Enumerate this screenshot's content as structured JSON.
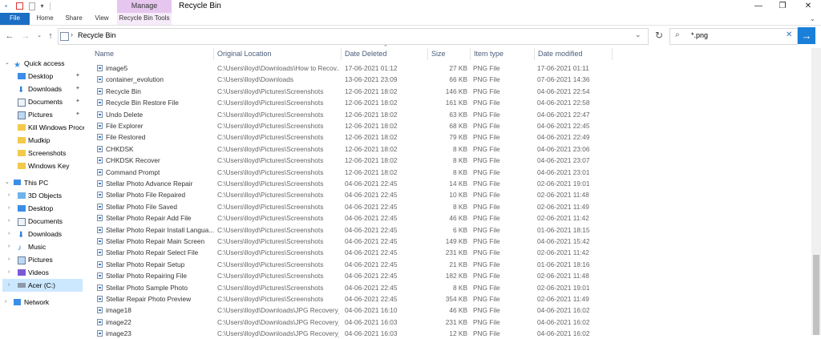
{
  "window": {
    "manage_label": "Manage",
    "title": "Recycle Bin",
    "minimize": "—",
    "restore": "❐",
    "close": "✕"
  },
  "ribbon": {
    "tabs": [
      "File",
      "Home",
      "Share",
      "View",
      "Recycle Bin Tools"
    ]
  },
  "address": {
    "location": "Recycle Bin",
    "search_query": "*.png"
  },
  "nav": {
    "quick_access": "Quick access",
    "quick_items": [
      "Desktop",
      "Downloads",
      "Documents",
      "Pictures",
      "Kill Windows Proces",
      "Mudkip",
      "Screenshots",
      "Windows Key"
    ],
    "this_pc": "This PC",
    "pc_items": [
      "3D Objects",
      "Desktop",
      "Documents",
      "Downloads",
      "Music",
      "Pictures",
      "Videos",
      "Acer (C:)"
    ],
    "network": "Network"
  },
  "columns": {
    "name": "Name",
    "location": "Original Location",
    "date_deleted": "Date Deleted",
    "size": "Size",
    "type": "Item type",
    "modified": "Date modified"
  },
  "files": [
    {
      "name": "image5",
      "loc": "C:\\Users\\lloyd\\Downloads\\How to Recov...",
      "deleted": "17-06-2021 01:12",
      "size": "27 KB",
      "type": "PNG File",
      "modified": "17-06-2021 01:11"
    },
    {
      "name": "container_evolution",
      "loc": "C:\\Users\\lloyd\\Downloads",
      "deleted": "13-06-2021 23:09",
      "size": "66 KB",
      "type": "PNG File",
      "modified": "07-06-2021 14:36"
    },
    {
      "name": "Recycle Bin",
      "loc": "C:\\Users\\lloyd\\Pictures\\Screenshots",
      "deleted": "12-06-2021 18:02",
      "size": "146 KB",
      "type": "PNG File",
      "modified": "04-06-2021 22:54"
    },
    {
      "name": "Recycle Bin Restore File",
      "loc": "C:\\Users\\lloyd\\Pictures\\Screenshots",
      "deleted": "12-06-2021 18:02",
      "size": "161 KB",
      "type": "PNG File",
      "modified": "04-06-2021 22:58"
    },
    {
      "name": "Undo Delete",
      "loc": "C:\\Users\\lloyd\\Pictures\\Screenshots",
      "deleted": "12-06-2021 18:02",
      "size": "63 KB",
      "type": "PNG File",
      "modified": "04-06-2021 22:47"
    },
    {
      "name": "File Explorer",
      "loc": "C:\\Users\\lloyd\\Pictures\\Screenshots",
      "deleted": "12-06-2021 18:02",
      "size": "68 KB",
      "type": "PNG File",
      "modified": "04-06-2021 22:45"
    },
    {
      "name": "File Restored",
      "loc": "C:\\Users\\lloyd\\Pictures\\Screenshots",
      "deleted": "12-06-2021 18:02",
      "size": "79 KB",
      "type": "PNG File",
      "modified": "04-06-2021 22:49"
    },
    {
      "name": "CHKDSK",
      "loc": "C:\\Users\\lloyd\\Pictures\\Screenshots",
      "deleted": "12-06-2021 18:02",
      "size": "8 KB",
      "type": "PNG File",
      "modified": "04-06-2021 23:06"
    },
    {
      "name": "CHKDSK Recover",
      "loc": "C:\\Users\\lloyd\\Pictures\\Screenshots",
      "deleted": "12-06-2021 18:02",
      "size": "8 KB",
      "type": "PNG File",
      "modified": "04-06-2021 23:07"
    },
    {
      "name": "Command Prompt",
      "loc": "C:\\Users\\lloyd\\Pictures\\Screenshots",
      "deleted": "12-06-2021 18:02",
      "size": "8 KB",
      "type": "PNG File",
      "modified": "04-06-2021 23:01"
    },
    {
      "name": "Stellar Photo Advance Repair",
      "loc": "C:\\Users\\lloyd\\Pictures\\Screenshots",
      "deleted": "04-06-2021 22:45",
      "size": "14 KB",
      "type": "PNG File",
      "modified": "02-06-2021 19:01"
    },
    {
      "name": "Stellar Photo File Repaired",
      "loc": "C:\\Users\\lloyd\\Pictures\\Screenshots",
      "deleted": "04-06-2021 22:45",
      "size": "10 KB",
      "type": "PNG File",
      "modified": "02-06-2021 11:48"
    },
    {
      "name": "Stellar Photo File Saved",
      "loc": "C:\\Users\\lloyd\\Pictures\\Screenshots",
      "deleted": "04-06-2021 22:45",
      "size": "8 KB",
      "type": "PNG File",
      "modified": "02-06-2021 11:49"
    },
    {
      "name": "Stellar Photo Repair Add File",
      "loc": "C:\\Users\\lloyd\\Pictures\\Screenshots",
      "deleted": "04-06-2021 22:45",
      "size": "46 KB",
      "type": "PNG File",
      "modified": "02-06-2021 11:42"
    },
    {
      "name": "Stellar Photo Repair Install Langua...",
      "loc": "C:\\Users\\lloyd\\Pictures\\Screenshots",
      "deleted": "04-06-2021 22:45",
      "size": "6 KB",
      "type": "PNG File",
      "modified": "01-06-2021 18:15"
    },
    {
      "name": "Stellar Photo Repair Main Screen",
      "loc": "C:\\Users\\lloyd\\Pictures\\Screenshots",
      "deleted": "04-06-2021 22:45",
      "size": "149 KB",
      "type": "PNG File",
      "modified": "04-06-2021 15:42"
    },
    {
      "name": "Stellar Photo Repair Select File",
      "loc": "C:\\Users\\lloyd\\Pictures\\Screenshots",
      "deleted": "04-06-2021 22:45",
      "size": "231 KB",
      "type": "PNG File",
      "modified": "02-06-2021 11:42"
    },
    {
      "name": "Stellar Photo Repair Setup",
      "loc": "C:\\Users\\lloyd\\Pictures\\Screenshots",
      "deleted": "04-06-2021 22:45",
      "size": "21 KB",
      "type": "PNG File",
      "modified": "01-06-2021 18:16"
    },
    {
      "name": "Stellar Photo Repairing File",
      "loc": "C:\\Users\\lloyd\\Pictures\\Screenshots",
      "deleted": "04-06-2021 22:45",
      "size": "182 KB",
      "type": "PNG File",
      "modified": "02-06-2021 11:48"
    },
    {
      "name": "Stellar Photo Sample Photo",
      "loc": "C:\\Users\\lloyd\\Pictures\\Screenshots",
      "deleted": "04-06-2021 22:45",
      "size": "8 KB",
      "type": "PNG File",
      "modified": "02-06-2021 19:01"
    },
    {
      "name": "Stellar Repair Photo Preview",
      "loc": "C:\\Users\\lloyd\\Pictures\\Screenshots",
      "deleted": "04-06-2021 22:45",
      "size": "354 KB",
      "type": "PNG File",
      "modified": "02-06-2021 11:49"
    },
    {
      "name": "image18",
      "loc": "C:\\Users\\lloyd\\Downloads\\JPG Recovery_...",
      "deleted": "04-06-2021 16:10",
      "size": "46 KB",
      "type": "PNG File",
      "modified": "04-06-2021 16:02"
    },
    {
      "name": "image22",
      "loc": "C:\\Users\\lloyd\\Downloads\\JPG Recovery_...",
      "deleted": "04-06-2021 16:03",
      "size": "231 KB",
      "type": "PNG File",
      "modified": "04-06-2021 16:02"
    },
    {
      "name": "image23",
      "loc": "C:\\Users\\lloyd\\Downloads\\JPG Recovery_...",
      "deleted": "04-06-2021 16:03",
      "size": "12 KB",
      "type": "PNG File",
      "modified": "04-06-2021 16:02"
    }
  ]
}
